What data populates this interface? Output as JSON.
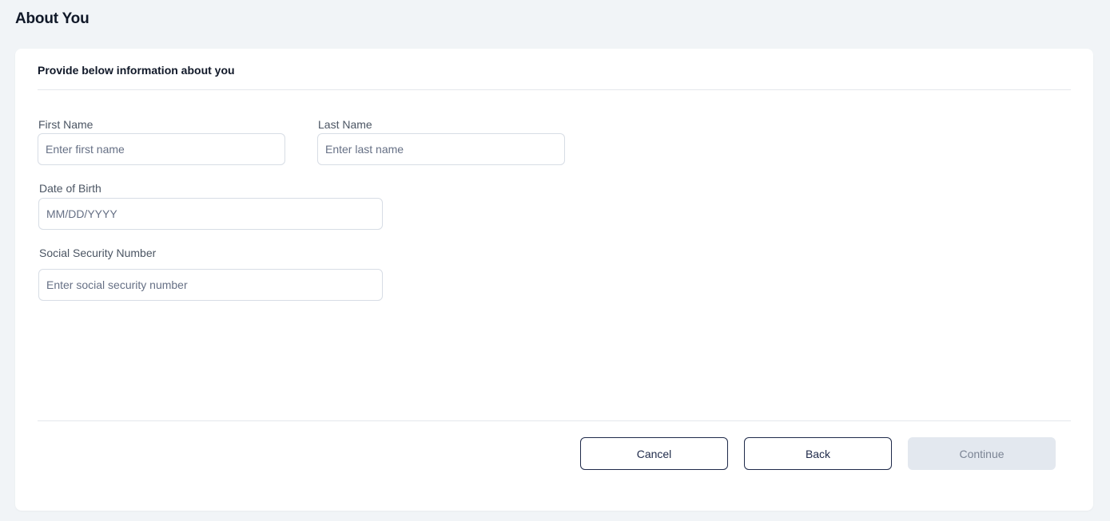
{
  "page": {
    "title": "About You"
  },
  "form": {
    "header": "Provide below information about you",
    "first_name": {
      "label": "First Name",
      "placeholder": "Enter first name",
      "value": ""
    },
    "last_name": {
      "label": "Last Name",
      "placeholder": "Enter last name",
      "value": ""
    },
    "dob": {
      "label": "Date of Birth",
      "placeholder": "MM/DD/YYYY",
      "value": ""
    },
    "ssn": {
      "label": "Social Security Number",
      "placeholder": "Enter social security number",
      "value": ""
    }
  },
  "actions": {
    "cancel_label": "Cancel",
    "back_label": "Back",
    "continue_label": "Continue",
    "continue_disabled": true
  },
  "colors": {
    "page_background": "#f1f4f7",
    "card_background": "#ffffff",
    "primary_outline": "#1f2a4a",
    "disabled_button": "#e3e8ef",
    "input_border": "#d7dde5"
  }
}
